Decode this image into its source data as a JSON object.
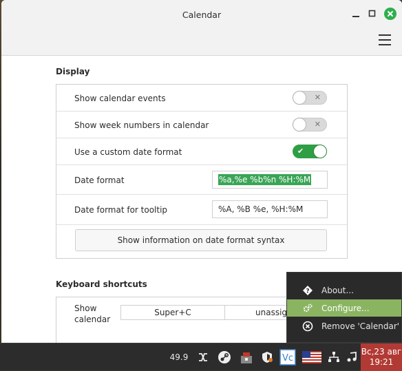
{
  "window": {
    "title": "Calendar"
  },
  "display": {
    "heading": "Display",
    "rows": [
      {
        "label": "Show calendar events",
        "toggle": "off"
      },
      {
        "label": "Show week numbers in calendar",
        "toggle": "off"
      },
      {
        "label": "Use a custom date format",
        "toggle": "on"
      },
      {
        "label": "Date format",
        "value": "%a,%e %b%n %H:%M"
      },
      {
        "label": "Date format for tooltip",
        "value": "%A, %B %e, %H:%M"
      }
    ],
    "syntax_button": "Show information on date format syntax"
  },
  "keyboard": {
    "heading": "Keyboard shortcuts",
    "label_line1": "Show",
    "label_line2": "calendar",
    "binding1": "Super+C",
    "binding2": "unassign"
  },
  "context_menu": {
    "items": [
      {
        "label": "About...",
        "icon": "question-icon"
      },
      {
        "label": "Configure...",
        "icon": "gear-icon",
        "highlighted": true
      },
      {
        "label": "Remove 'Calendar'",
        "icon": "remove-icon"
      }
    ]
  },
  "taskbar": {
    "indicator_value": "49.9",
    "clock_date": "Вс,23 авг",
    "clock_time": "19:21"
  },
  "colors": {
    "accent_green": "#2f9e44",
    "menu_highlight": "#8ab461",
    "clock_bg": "#b23a34"
  }
}
